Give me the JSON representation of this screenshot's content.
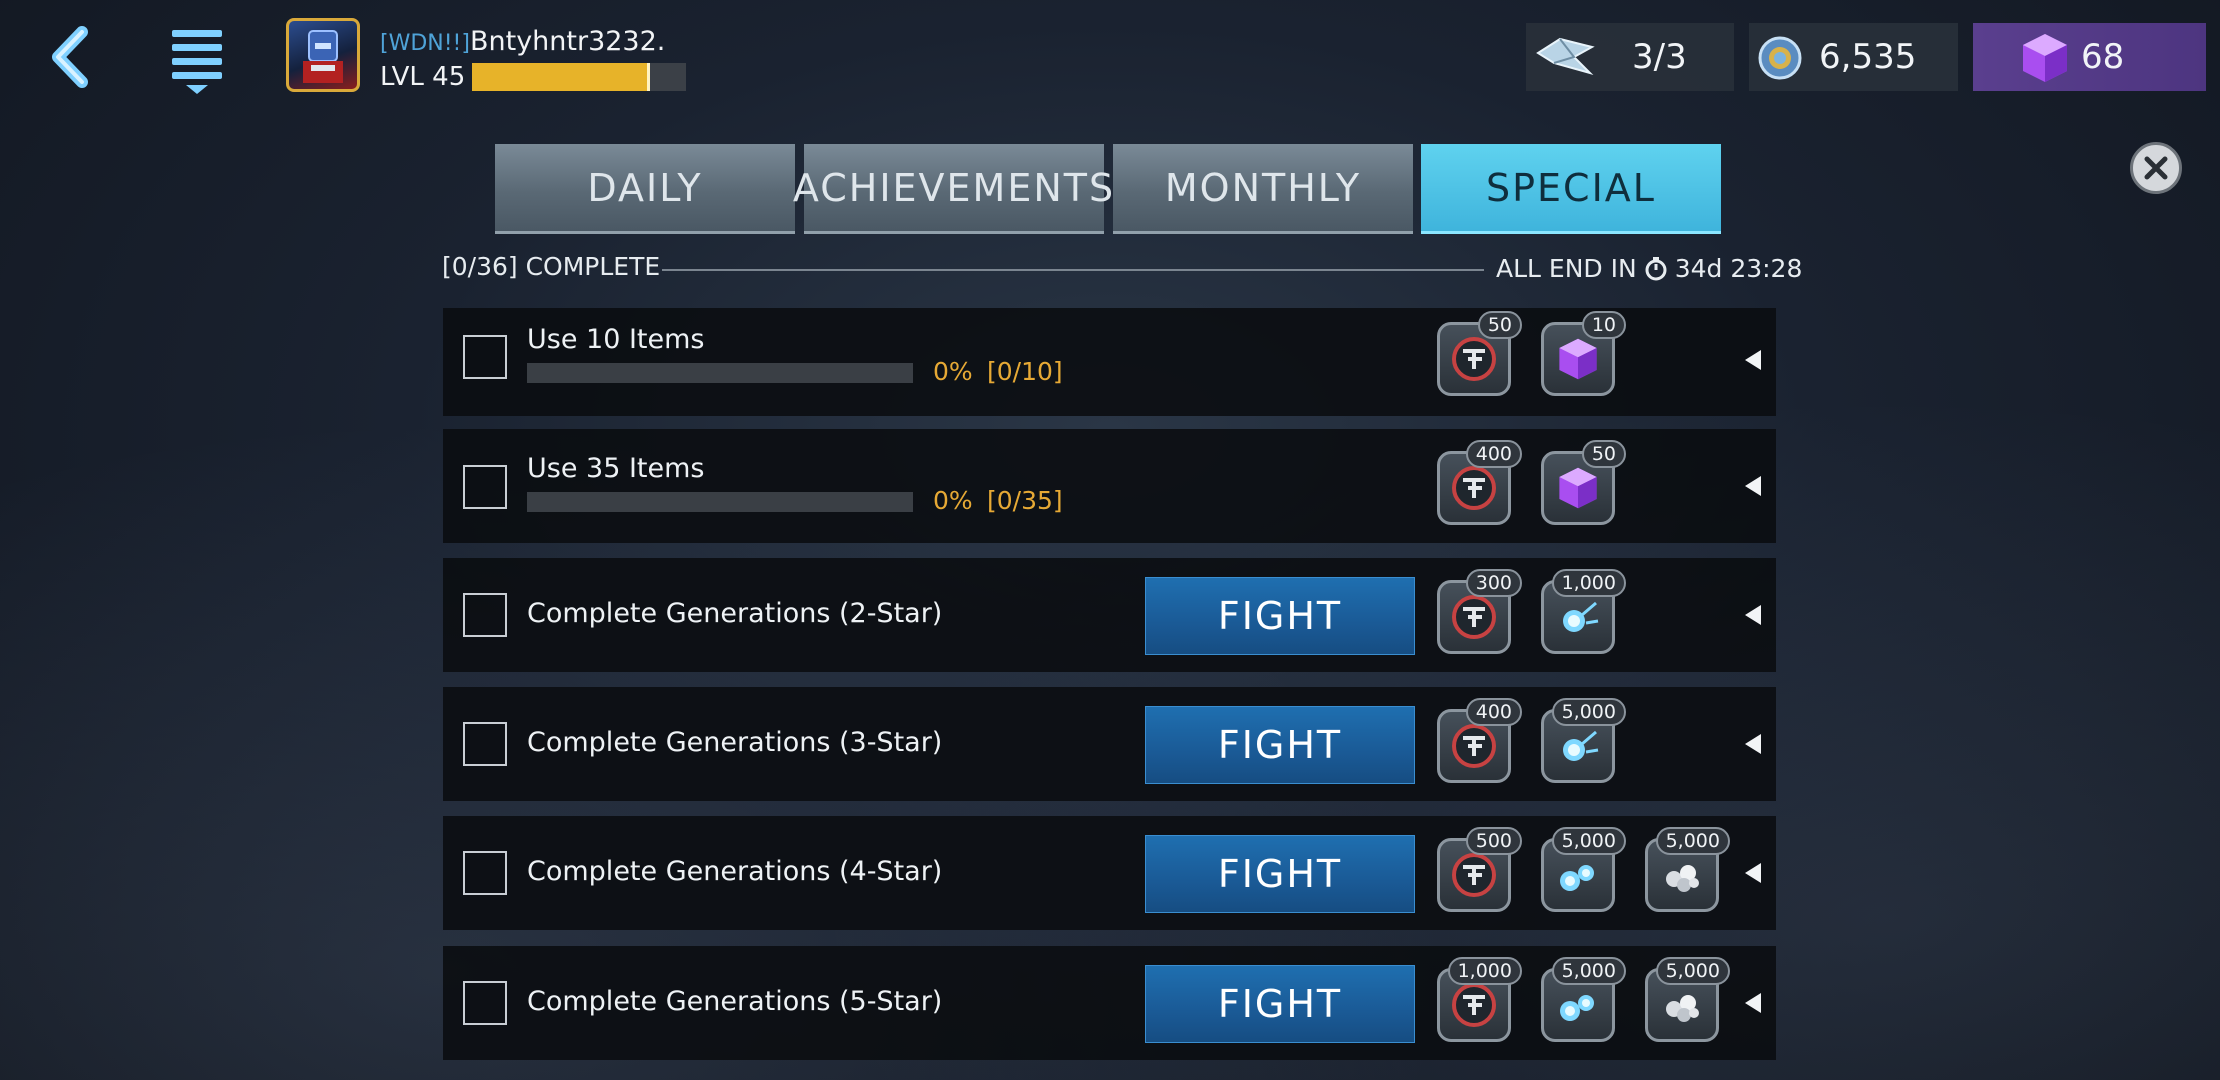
{
  "header": {
    "player_tag": "[WDN!!]",
    "player_name": "Bntyhntr3232.",
    "level_label": "LVL 45",
    "xp_progress": 0.83
  },
  "currencies": [
    {
      "icon": "energy-shard-icon",
      "amount": "3/3"
    },
    {
      "icon": "credits-coin-icon",
      "amount": "6,535"
    },
    {
      "icon": "purple-cube-icon",
      "amount": "68"
    }
  ],
  "tabs": [
    {
      "label": "DAILY",
      "active": false
    },
    {
      "label": "ACHIEVEMENTS",
      "active": false
    },
    {
      "label": "MONTHLY",
      "active": false
    },
    {
      "label": "SPECIAL",
      "active": true
    }
  ],
  "summary": {
    "complete": "[0/36] COMPLETE",
    "ends_label": "ALL END IN",
    "ends_time": "34d 23:28"
  },
  "quests": [
    {
      "title": "Use 10 Items",
      "progress": "0%",
      "count": "[0/10]",
      "progress_value": 0,
      "rewards": [
        {
          "icon": "tf-badge-icon",
          "amount": "50"
        },
        {
          "icon": "purple-cube-icon",
          "amount": "10"
        }
      ]
    },
    {
      "title": "Use 35 Items",
      "progress": "0%",
      "count": "[0/35]",
      "progress_value": 0,
      "rewards": [
        {
          "icon": "tf-badge-icon",
          "amount": "400"
        },
        {
          "icon": "purple-cube-icon",
          "amount": "50"
        }
      ]
    },
    {
      "title": "Complete Generations (2-Star)",
      "fight": "FIGHT",
      "rewards": [
        {
          "icon": "tf-badge-icon",
          "amount": "300"
        },
        {
          "icon": "energon-orb-icon",
          "amount": "1,000"
        }
      ]
    },
    {
      "title": "Complete Generations (3-Star)",
      "fight": "FIGHT",
      "rewards": [
        {
          "icon": "tf-badge-icon",
          "amount": "400"
        },
        {
          "icon": "energon-orb-icon",
          "amount": "5,000"
        }
      ]
    },
    {
      "title": "Complete Generations (4-Star)",
      "fight": "FIGHT",
      "rewards": [
        {
          "icon": "tf-badge-icon",
          "amount": "500"
        },
        {
          "icon": "energon-orbs-icon",
          "amount": "5,000"
        },
        {
          "icon": "silver-orbs-icon",
          "amount": "5,000"
        }
      ]
    },
    {
      "title": "Complete Generations (5-Star)",
      "fight": "FIGHT",
      "rewards": [
        {
          "icon": "tf-badge-icon",
          "amount": "1,000"
        },
        {
          "icon": "energon-orbs-icon",
          "amount": "5,000"
        },
        {
          "icon": "silver-orbs-icon",
          "amount": "5,000"
        }
      ]
    }
  ]
}
